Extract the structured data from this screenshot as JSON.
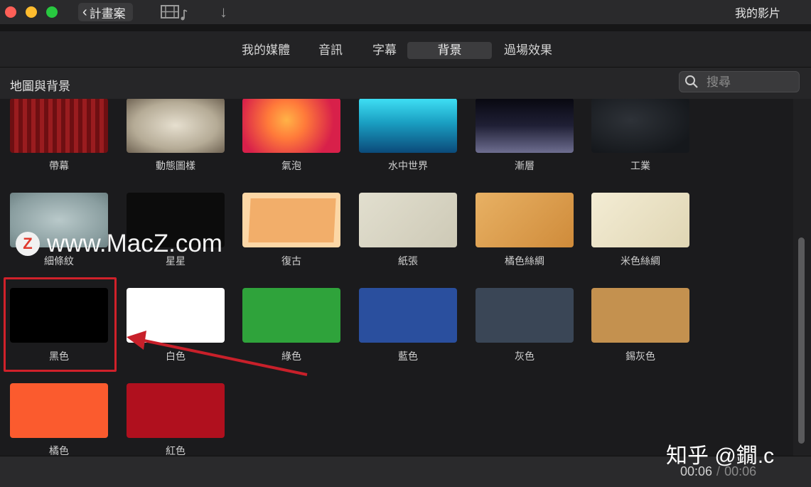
{
  "window": {
    "back_label": "計畫案",
    "project_title": "我的影片",
    "media_icon": "film-music-icon",
    "import_icon": "download-arrow-icon"
  },
  "tabs": [
    {
      "label": "我的媒體",
      "active": false
    },
    {
      "label": "音訊",
      "active": false
    },
    {
      "label": "字幕",
      "active": false
    },
    {
      "label": "背景",
      "active": true
    },
    {
      "label": "過場效果",
      "active": false
    }
  ],
  "section": {
    "title": "地圖與背景",
    "search_placeholder": "搜尋"
  },
  "backgrounds": [
    {
      "label": "帶幕",
      "color": "#8b1a1a"
    },
    {
      "label": "動態圖樣",
      "color": "#bfb6a4"
    },
    {
      "label": "氣泡",
      "color": "#e8364a"
    },
    {
      "label": "水中世界",
      "color": "#1fa4c4"
    },
    {
      "label": "漸層",
      "color": "#3a3a52"
    },
    {
      "label": "工業",
      "color": "#1c1f24"
    },
    {
      "label": "細條紋",
      "color": "#9db0b2"
    },
    {
      "label": "星星",
      "color": "#0c0c0c"
    },
    {
      "label": "復古",
      "color": "#f4b97a"
    },
    {
      "label": "紙張",
      "color": "#d9d6c6"
    },
    {
      "label": "橘色絲綢",
      "color": "#dca04e"
    },
    {
      "label": "米色絲綢",
      "color": "#ece5cc"
    },
    {
      "label": "黑色",
      "color": "#000000"
    },
    {
      "label": "白色",
      "color": "#ffffff"
    },
    {
      "label": "綠色",
      "color": "#2fa33b"
    },
    {
      "label": "藍色",
      "color": "#2a4f9e"
    },
    {
      "label": "灰色",
      "color": "#3a4656"
    },
    {
      "label": "錫灰色",
      "color": "#c4914f"
    },
    {
      "label": "橘色",
      "color": "#fb5b2e"
    },
    {
      "label": "紅色",
      "color": "#b0101e"
    }
  ],
  "watermark": {
    "logo_letter": "Z",
    "text": "www.MacZ.com",
    "zhihu": "知乎 @鐗.c"
  },
  "timecode": {
    "current": "00:06",
    "separator": "/",
    "total": "00:06"
  },
  "accent": "#d0212a"
}
